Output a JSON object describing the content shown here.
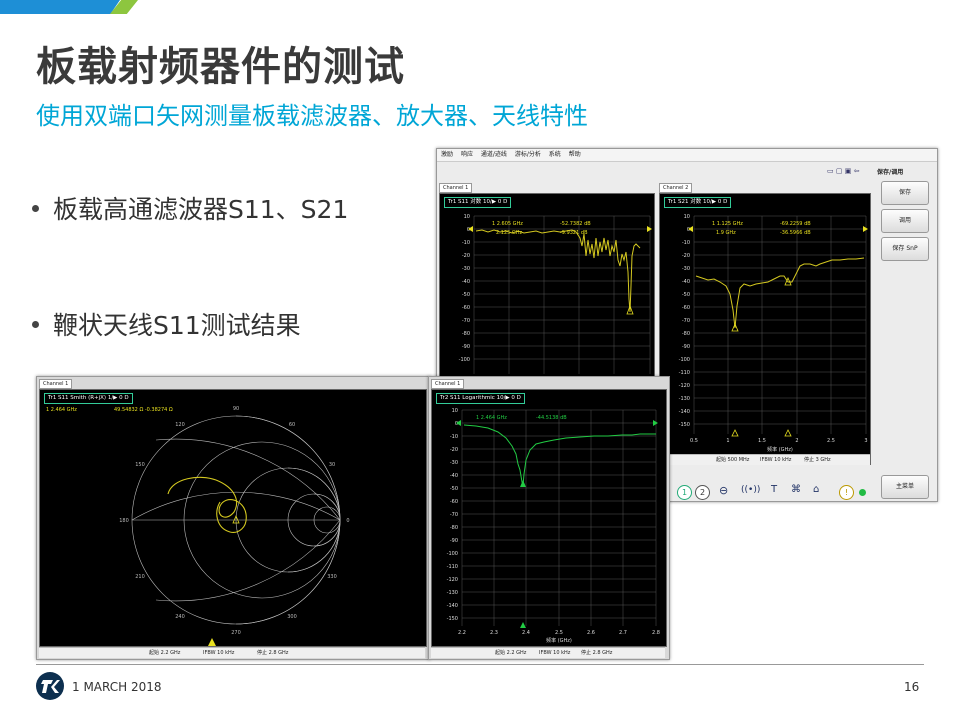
{
  "slide": {
    "title": "板载射频器件的测试",
    "subtitle": "使用双端口矢网测量板载滤波器、放大器、天线特性",
    "bullets": [
      "板载高通滤波器S11、S21",
      "鞭状天线S11测试结果"
    ],
    "footer_date": "1 MARCH 2018",
    "page_number": "16"
  },
  "vna": {
    "menu": [
      "激励",
      "响应",
      "通道/迹线",
      "游标/分析",
      "系统",
      "帮助"
    ],
    "side_panel_title": "保存/调用",
    "side_buttons": [
      "保存",
      "调用",
      "保存 SnP"
    ],
    "main_menu_button": "主菜单",
    "ch1": {
      "label": "Channel 1",
      "trace": "Tr1  S11  对数  10/▶  0  D",
      "marker1": "1  2.605 GHz",
      "marker1_val": "-52.7382 dB",
      "marker2": "2.125 GHz",
      "marker2_val": "-9.9321 dB",
      "y_ticks": [
        "10",
        "0",
        "-10",
        "-20",
        "-30",
        "-40",
        "-50",
        "-60",
        "-70",
        "-80",
        "-90",
        "-100"
      ]
    },
    "ch2": {
      "label": "Channel 2",
      "trace": "Tr1  S21  对数  10/▶  0  D",
      "marker1": "1  1.125 GHz",
      "marker1_val": "-69.2259 dB",
      "marker2": "1.9 GHz",
      "marker2_val": "-36.5966 dB",
      "y_ticks": [
        "10",
        "0",
        "-10",
        "-20",
        "-30",
        "-40",
        "-50",
        "-60",
        "-70",
        "-80",
        "-90",
        "-100",
        "-110",
        "-120",
        "-130",
        "-140",
        "-150"
      ],
      "x_ticks": [
        "0.5",
        "1",
        "1.5",
        "2",
        "2.5",
        "3"
      ],
      "x_label": "频率 (GHz)",
      "status": [
        "起始 500 MHz",
        "IFBW 10 kHz",
        "停止 3 GHz"
      ]
    },
    "colors": {
      "trace_yellow": "#d4c820",
      "trace_green": "#22cc44",
      "accent": "#00a6d6"
    }
  },
  "smith": {
    "label": "Channel 1",
    "trace": "Tr1  S11  Smith (R+jX)  1/▶  0  D",
    "marker": "1  2.464 GHz",
    "marker_val": "49.54832 Ω  -0.38274 Ω",
    "ring_labels": [
      "90",
      "120",
      "60",
      "150",
      "30",
      "180",
      "0",
      "210",
      "330",
      "240",
      "300",
      "270"
    ],
    "status": [
      "起始 2.2 GHz",
      "IFBW 10 kHz",
      "停止 2.8 GHz"
    ]
  },
  "antenna": {
    "label": "Channel 1",
    "trace": "Tr2  S11  Logarithmic  10/▶  0  D",
    "marker": "1  2.464 GHz",
    "marker_val": "-44.5138 dB",
    "y_ticks": [
      "10",
      "0",
      "-10",
      "-20",
      "-30",
      "-40",
      "-50",
      "-60",
      "-70",
      "-80",
      "-90",
      "-100",
      "-110",
      "-120",
      "-130",
      "-140",
      "-150"
    ],
    "x_ticks": [
      "2.2",
      "2.3",
      "2.4",
      "2.5",
      "2.6",
      "2.7",
      "2.8"
    ],
    "x_label": "频率 (GHz)",
    "status": [
      "起始 2.2 GHz",
      "IFBW 10 kHz",
      "停止 2.8 GHz"
    ]
  }
}
